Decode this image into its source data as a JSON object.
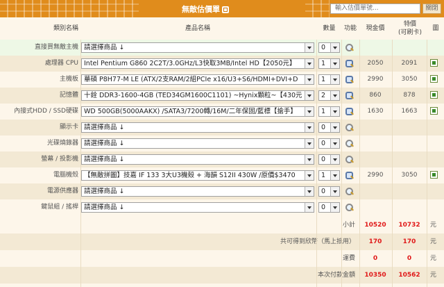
{
  "header": {
    "title": "無敵估價單",
    "search_placeholder": "輸入估價單號...",
    "close_label": "關閉"
  },
  "columns": {
    "category": "類別名稱",
    "product": "產品名稱",
    "qty": "數量",
    "func": "功能",
    "cash": "現金價",
    "special_line1": "特價",
    "special_line2": "(可刷卡)",
    "pic": "圖"
  },
  "rows": [
    {
      "label": "直接買無敵主機",
      "product": "請選擇商品 ↓",
      "qty": "0",
      "cash": "",
      "special": "",
      "icon": "magnifier-icon",
      "pic": false
    },
    {
      "label": "處理器 CPU",
      "product": "Intel Pentium G860 2C2T/3.0GHz/L3快取3MB/Intel HD【2050元】",
      "qty": "1",
      "cash": "2050",
      "special": "2091",
      "icon": "cart-icon",
      "pic": true
    },
    {
      "label": "主機板",
      "product": "華碩 P8H77-M LE (ATX/2支RAM/2組PCIe x16/U3+S6/HDMI+DVI+D",
      "qty": "1",
      "cash": "2990",
      "special": "3050",
      "icon": "cart-icon",
      "pic": true
    },
    {
      "label": "記憶體",
      "product": "十銓 DDR3-1600-4GB (TED34GM1600C1101) ~Hynix顆粒~【430元",
      "qty": "2",
      "cash": "860",
      "special": "878",
      "icon": "cart-icon",
      "pic": true
    },
    {
      "label": "內接式HDD / SSD硬碟",
      "product": "WD 500GB(5000AAKX) /SATA3/7200轉/16M/二年保固/藍標【搶手】",
      "qty": "1",
      "cash": "1630",
      "special": "1663",
      "icon": "cart-icon",
      "pic": true
    },
    {
      "label": "顯示卡",
      "product": "請選擇商品 ↓",
      "qty": "0",
      "cash": "",
      "special": "",
      "icon": "magnifier-icon",
      "pic": false
    },
    {
      "label": "光碟燒錄器",
      "product": "請選擇商品 ↓",
      "qty": "0",
      "cash": "",
      "special": "",
      "icon": "magnifier-icon",
      "pic": false
    },
    {
      "label": "螢幕 / 投影機",
      "product": "請選擇商品 ↓",
      "qty": "0",
      "cash": "",
      "special": "",
      "icon": "magnifier-icon",
      "pic": false
    },
    {
      "label": "電腦機殼",
      "product": "【無敵拼圖】技嘉 IF 133 3大U3機殼 + 海韻 S12II 430W /原價$3470",
      "qty": "1",
      "cash": "2990",
      "special": "3050",
      "icon": "cart-icon",
      "pic": true
    },
    {
      "label": "電源供應器",
      "product": "請選擇商品 ↓",
      "qty": "0",
      "cash": "",
      "special": "",
      "icon": "magnifier-icon",
      "pic": false
    },
    {
      "label": "鍵鼠組 / 搖桿",
      "product": "請選擇商品 ↓",
      "qty": "0",
      "cash": "",
      "special": "",
      "icon": "magnifier-icon",
      "pic": false
    }
  ],
  "summary": [
    {
      "label": "小計",
      "cash": "10520",
      "special": "10732",
      "unit": "元"
    },
    {
      "label": "共可得到欣幣（馬上抵用）",
      "cash": "170",
      "special": "170",
      "unit": "元"
    },
    {
      "label": "運費",
      "cash": "0",
      "special": "0",
      "unit": "元"
    },
    {
      "label": "本次付款金額",
      "cash": "10350",
      "special": "10562",
      "unit": "元"
    }
  ],
  "colors": {
    "header": "#e08c1c",
    "accent_red": "#e01818",
    "row_alt": "#f3e9d4"
  }
}
